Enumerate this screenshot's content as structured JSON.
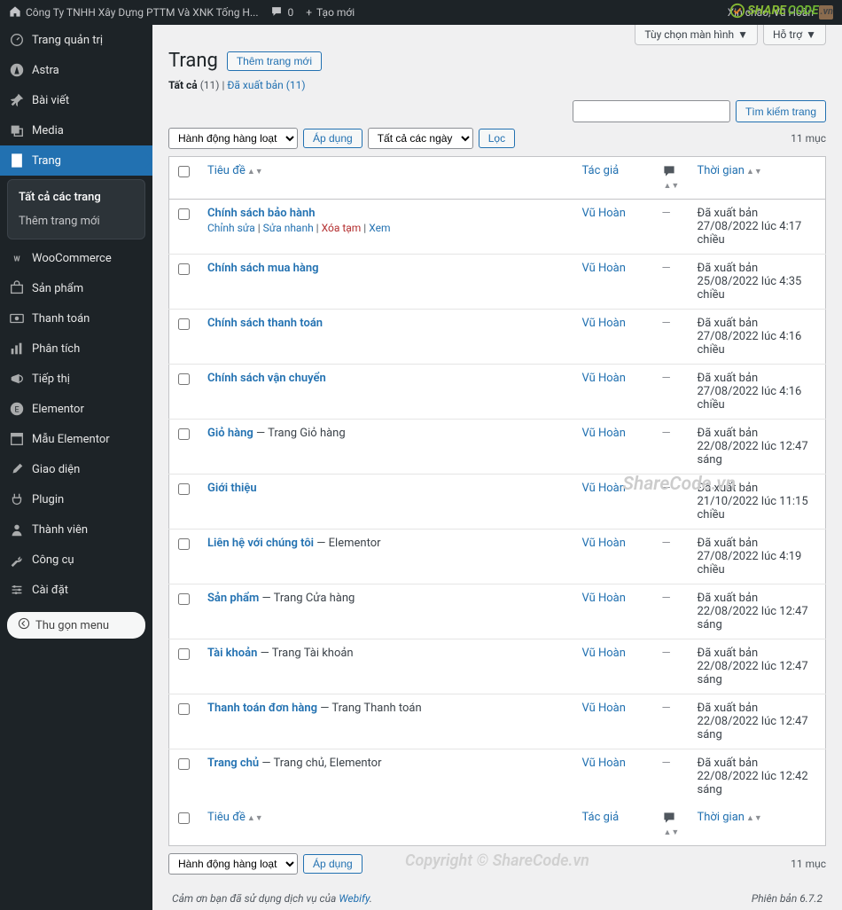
{
  "toolbar": {
    "site_name": "Công Ty TNHH Xây Dựng PTTM Và XNK Tống H...",
    "comments_count": "0",
    "new_label": "Tạo mới",
    "greeting": "Xin chào, Vũ Hoàn"
  },
  "watermark": {
    "text1": "SHARE",
    "text2": "CODE",
    "ext": ".vn",
    "center": "ShareCode.vn",
    "copyright": "Copyright © ShareCode.vn"
  },
  "sidebar": {
    "items": [
      {
        "id": "dashboard",
        "label": "Trang quản trị",
        "icon": "gauge"
      },
      {
        "id": "astra",
        "label": "Astra",
        "icon": "astra"
      },
      {
        "id": "posts",
        "label": "Bài viết",
        "icon": "pin"
      },
      {
        "id": "media",
        "label": "Media",
        "icon": "media"
      },
      {
        "id": "pages",
        "label": "Trang",
        "icon": "page",
        "current": true
      },
      {
        "id": "woocommerce",
        "label": "WooCommerce",
        "icon": "woo"
      },
      {
        "id": "products",
        "label": "Sản phẩm",
        "icon": "cart"
      },
      {
        "id": "payments",
        "label": "Thanh toán",
        "icon": "money"
      },
      {
        "id": "analytics",
        "label": "Phân tích",
        "icon": "bars"
      },
      {
        "id": "marketing",
        "label": "Tiếp thị",
        "icon": "megaphone"
      },
      {
        "id": "elementor",
        "label": "Elementor",
        "icon": "elem"
      },
      {
        "id": "templates",
        "label": "Mẫu Elementor",
        "icon": "tpl"
      },
      {
        "id": "appearance",
        "label": "Giao diện",
        "icon": "brush"
      },
      {
        "id": "plugins",
        "label": "Plugin",
        "icon": "plug"
      },
      {
        "id": "users",
        "label": "Thành viên",
        "icon": "user"
      },
      {
        "id": "tools",
        "label": "Công cụ",
        "icon": "wrench"
      },
      {
        "id": "settings",
        "label": "Cài đặt",
        "icon": "sliders"
      }
    ],
    "submenu": [
      {
        "label": "Tất cả các trang",
        "active": true
      },
      {
        "label": "Thêm trang mới",
        "active": false
      }
    ],
    "collapse_label": "Thu gọn menu"
  },
  "screen": {
    "options_label": "Tùy chọn màn hình",
    "help_label": "Hỗ trợ"
  },
  "page": {
    "title": "Trang",
    "add_new": "Thêm trang mới",
    "all_label": "Tất cả",
    "all_count": "(11)",
    "published_label": "Đã xuất bản",
    "published_count": "(11)",
    "bulk_action": "Hành động hàng loạt",
    "apply": "Áp dụng",
    "all_dates": "Tất cả các ngày",
    "filter": "Lọc",
    "items_count": "11 mục",
    "search_btn": "Tìm kiếm trang",
    "footer_thank1": "Cảm ơn bạn đã sử dụng dịch vụ của ",
    "footer_link": "Webify",
    "version": "Phiên bản 6.7.2"
  },
  "columns": {
    "title": "Tiêu đề",
    "author": "Tác giả",
    "date": "Thời gian"
  },
  "row_actions": {
    "edit": "Chỉnh sửa",
    "quick": "Sửa nhanh",
    "trash": "Xóa tạm",
    "view": "Xem"
  },
  "rows": [
    {
      "title": "Chính sách bảo hành",
      "extra": "",
      "actions": true,
      "author": "Vũ Hoàn",
      "status": "Đã xuất bản",
      "date": "27/08/2022 lúc 4:17 chiều"
    },
    {
      "title": "Chính sách mua hàng",
      "extra": "",
      "author": "Vũ Hoàn",
      "status": "Đã xuất bản",
      "date": "25/08/2022 lúc 4:35 chiều"
    },
    {
      "title": "Chính sách thanh toán",
      "extra": "",
      "author": "Vũ Hoàn",
      "status": "Đã xuất bản",
      "date": "27/08/2022 lúc 4:16 chiều"
    },
    {
      "title": "Chính sách vận chuyển",
      "extra": "",
      "author": "Vũ Hoàn",
      "status": "Đã xuất bản",
      "date": "27/08/2022 lúc 4:16 chiều"
    },
    {
      "title": "Giỏ hàng",
      "extra": " — Trang Giỏ hàng",
      "author": "Vũ Hoàn",
      "status": "Đã xuất bản",
      "date": "22/08/2022 lúc 12:47 sáng"
    },
    {
      "title": "Giới thiệu",
      "extra": "",
      "author": "Vũ Hoàn",
      "status": "Đã xuất bản",
      "date": "21/10/2022 lúc 11:15 chiều"
    },
    {
      "title": "Liên hệ với chúng tôi",
      "extra": " — Elementor",
      "author": "Vũ Hoàn",
      "status": "Đã xuất bản",
      "date": "27/08/2022 lúc 4:19 chiều"
    },
    {
      "title": "Sản phẩm",
      "extra": " — Trang Cửa hàng",
      "author": "Vũ Hoàn",
      "status": "Đã xuất bản",
      "date": "22/08/2022 lúc 12:47 sáng"
    },
    {
      "title": "Tài khoản",
      "extra": " — Trang Tài khoản",
      "author": "Vũ Hoàn",
      "status": "Đã xuất bản",
      "date": "22/08/2022 lúc 12:47 sáng"
    },
    {
      "title": "Thanh toán đơn hàng",
      "extra": " — Trang Thanh toán",
      "author": "Vũ Hoàn",
      "status": "Đã xuất bản",
      "date": "22/08/2022 lúc 12:47 sáng"
    },
    {
      "title": "Trang chủ",
      "extra": " — Trang chủ, Elementor",
      "author": "Vũ Hoàn",
      "status": "Đã xuất bản",
      "date": "22/08/2022 lúc 12:42 sáng"
    }
  ]
}
